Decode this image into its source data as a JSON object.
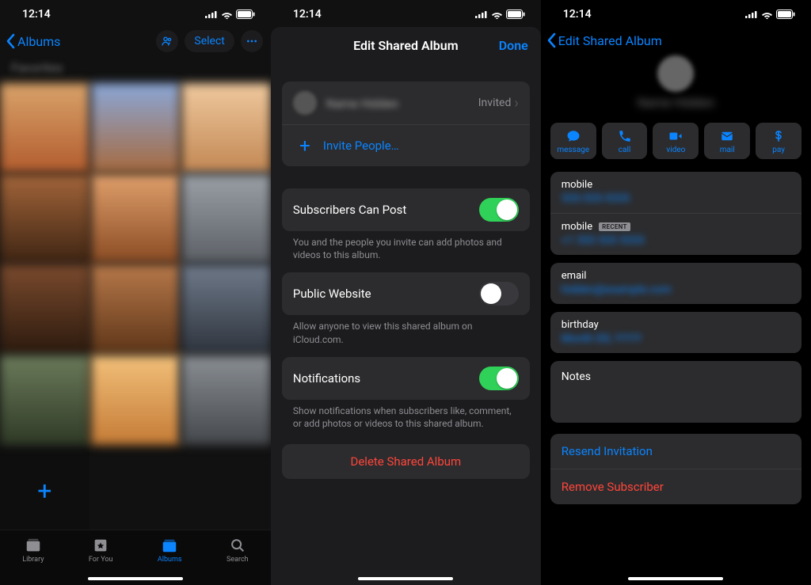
{
  "status": {
    "time": "12:14"
  },
  "screen1": {
    "back_label": "Albums",
    "select_label": "Select",
    "album_title_blurred": "Favorites",
    "tabs": {
      "library": "Library",
      "foryou": "For You",
      "albums": "Albums",
      "search": "Search"
    },
    "grid_cells": [
      {
        "bg": "linear-gradient(180deg,#d9a36a,#b25c2e)"
      },
      {
        "bg": "linear-gradient(180deg,#8aa7d8,#a66a3f)"
      },
      {
        "bg": "linear-gradient(180deg,#efc99e,#c28753)"
      },
      {
        "bg": "linear-gradient(180deg,#a3653a,#3f2513)"
      },
      {
        "bg": "linear-gradient(180deg,#e0a06c,#8a4b23)"
      },
      {
        "bg": "linear-gradient(180deg,#9aa0a6,#5c6066)"
      },
      {
        "bg": "linear-gradient(180deg,#7a4a2d,#2c1a0e)"
      },
      {
        "bg": "linear-gradient(180deg,#b7794a,#5e3518)"
      },
      {
        "bg": "linear-gradient(180deg,#6f7a8a,#2e343d)"
      },
      {
        "bg": "linear-gradient(180deg,#6b7a5a,#2f3a26)"
      },
      {
        "bg": "linear-gradient(180deg,#f2c07a,#c47b36)"
      },
      {
        "bg": "linear-gradient(180deg,#8a8f94,#44474b)"
      }
    ]
  },
  "screen2": {
    "title": "Edit Shared Album",
    "done": "Done",
    "invitee_name_blurred": "Name Hidden",
    "invitee_status": "Invited",
    "invite_people": "Invite People…",
    "settings": {
      "subscribers_post": {
        "label": "Subscribers Can Post",
        "on": true,
        "help": "You and the people you invite can add photos and videos to this album."
      },
      "public_website": {
        "label": "Public Website",
        "on": false,
        "help": "Allow anyone to view this shared album on iCloud.com."
      },
      "notifications": {
        "label": "Notifications",
        "on": true,
        "help": "Show notifications when subscribers like, comment, or add photos or videos to this shared album."
      }
    },
    "delete_label": "Delete Shared Album"
  },
  "screen3": {
    "back_label": "Edit Shared Album",
    "contact_name_blurred": "Name Hidden",
    "actions": {
      "message": "message",
      "call": "call",
      "video": "video",
      "mail": "mail",
      "pay": "pay"
    },
    "fields": {
      "mobile1_label": "mobile",
      "mobile1_value_blurred": "555-555-5555",
      "mobile2_label": "mobile",
      "mobile2_badge": "RECENT",
      "mobile2_value_blurred": "+1 555 555 5555",
      "email_label": "email",
      "email_value_blurred": "hidden@example.com",
      "birthday_label": "birthday",
      "birthday_value_blurred": "Month DD, YYYY",
      "notes_label": "Notes"
    },
    "resend": "Resend Invitation",
    "remove": "Remove Subscriber"
  }
}
